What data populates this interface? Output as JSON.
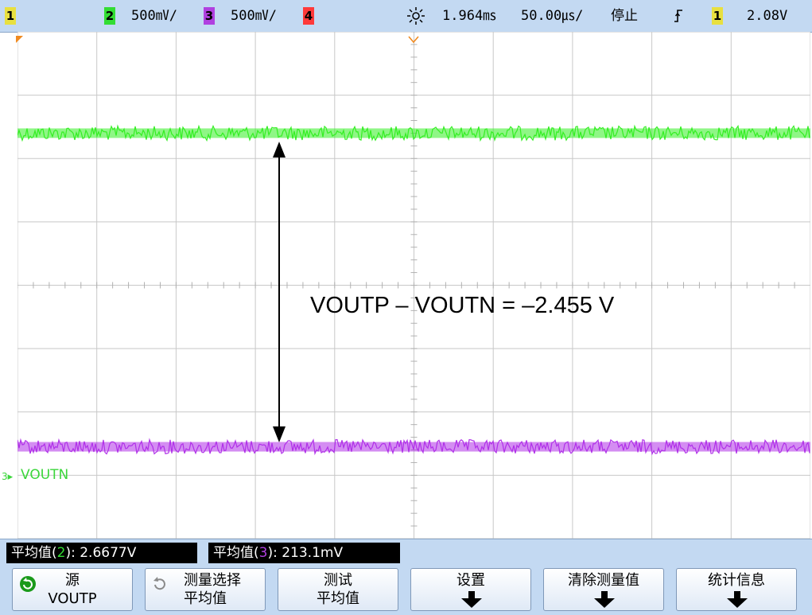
{
  "status_bar": {
    "ch1_badge": "1",
    "ch2_badge": "2",
    "ch2_scale": "500㎷/",
    "ch3_badge": "3",
    "ch3_scale": "500㎷/",
    "ch4_badge": "4",
    "time_ref_icon": "sun-icon",
    "time_delay": "1.964㎳",
    "time_scale": "50.00㎲/",
    "run_state": "停止",
    "trigger_icon": "trigger-edge-icon",
    "trigger_source_badge": "1",
    "trigger_level": "2.08V"
  },
  "colors": {
    "ch1": "#e8e040",
    "ch2": "#33dd33",
    "ch3": "#b040e0",
    "ch4": "#ff3a3a",
    "trace_ch2": "#33ee22",
    "trace_ch3": "#b030e8",
    "grid": "#c8c8c8"
  },
  "traces": [
    {
      "channel": "2",
      "level_divisions_from_top": 1.6
    },
    {
      "channel": "3",
      "level_divisions_from_top": 6.55
    }
  ],
  "screen": {
    "channel_label_prefix": "3",
    "channel_label": "VOUTN",
    "annotation": "VOUTP – VOUTN = –2.455 V"
  },
  "measurements": {
    "m1_prefix": "平均值(",
    "m1_channel": "2",
    "m1_suffix": "): 2.6677V",
    "m2_prefix": "平均值(",
    "m2_channel": "3",
    "m2_suffix": "): 213.1mV"
  },
  "softkeys": [
    {
      "line1": "源",
      "line2": "VOUTP",
      "icon": "rotate-knob-icon"
    },
    {
      "line1": "测量选择",
      "line2": "平均值",
      "icon": "rotate-knob-icon"
    },
    {
      "line1": "测试",
      "line2": "平均值"
    },
    {
      "line1": "设置",
      "icon": "down-arrow-icon"
    },
    {
      "line1": "清除测量值",
      "icon": "down-arrow-icon"
    },
    {
      "line1": "统计信息",
      "icon": "down-arrow-icon"
    }
  ]
}
